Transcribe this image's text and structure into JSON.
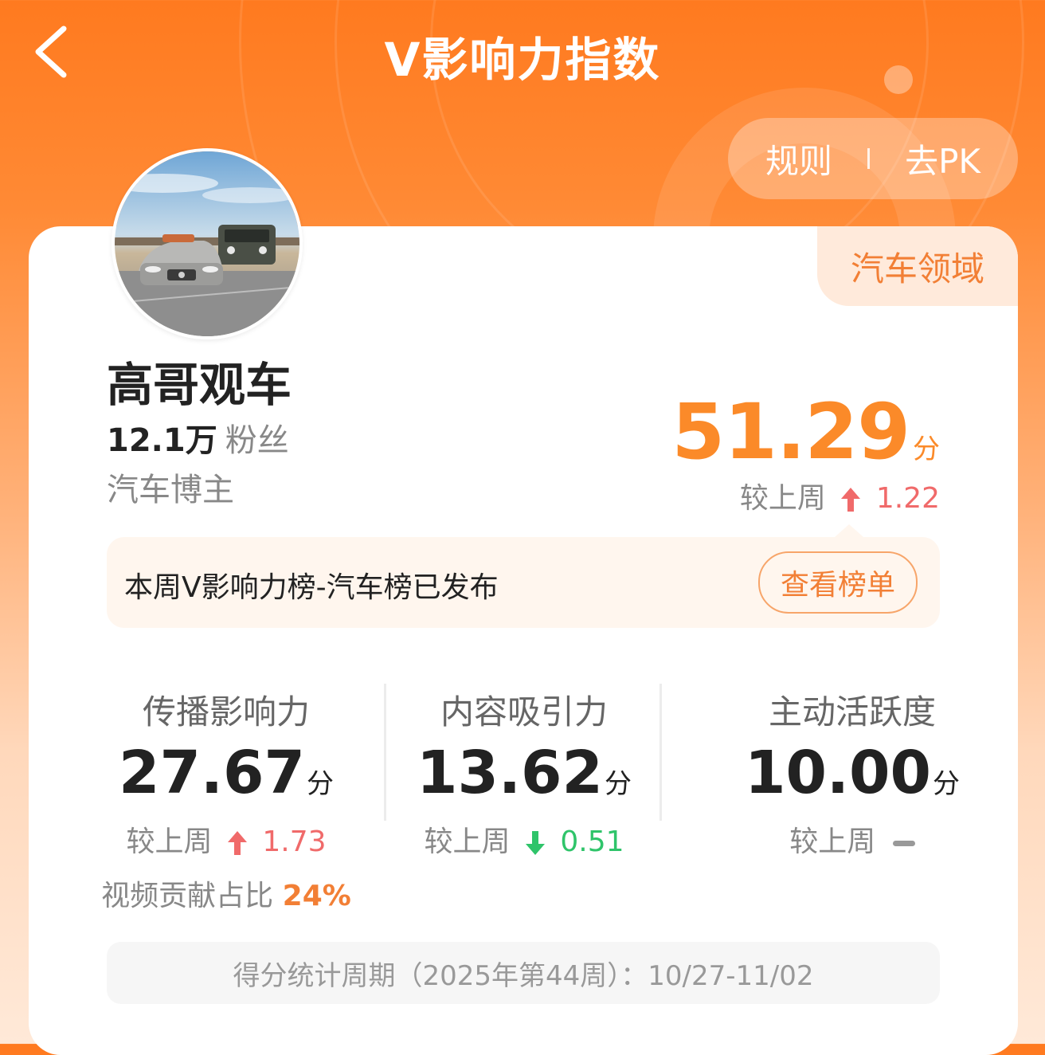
{
  "header": {
    "title": "V影响力指数",
    "rules_label": "规则",
    "pk_label": "去PK"
  },
  "profile": {
    "domain_tag": "汽车领域",
    "name": "高哥观车",
    "fans_count": "12.1万",
    "fans_label": "粉丝",
    "role": "汽车博主"
  },
  "score": {
    "value": "51.29",
    "unit": "分",
    "compare_label": "较上周",
    "change": "1.22",
    "direction": "up"
  },
  "notice": {
    "text": "本周V影响力榜-汽车榜已发布",
    "button": "查看榜单"
  },
  "metrics": [
    {
      "label": "传播影响力",
      "value": "27.67",
      "unit": "分",
      "compare_label": "较上周",
      "change": "1.73",
      "direction": "up",
      "extra_label": "视频贡献占比",
      "extra_value": "24%"
    },
    {
      "label": "内容吸引力",
      "value": "13.62",
      "unit": "分",
      "compare_label": "较上周",
      "change": "0.51",
      "direction": "down"
    },
    {
      "label": "主动活跃度",
      "value": "10.00",
      "unit": "分",
      "compare_label": "较上周",
      "change": "",
      "direction": "flat"
    }
  ],
  "footer": {
    "period": "得分统计周期（2025年第44周）：10/27-11/02"
  },
  "colors": {
    "accent": "#fb8a29",
    "up": "#f06a6a",
    "down": "#2fc46a"
  },
  "icons": [
    "back-chevron-icon",
    "arrow-up-icon",
    "arrow-down-icon",
    "dash-icon"
  ]
}
